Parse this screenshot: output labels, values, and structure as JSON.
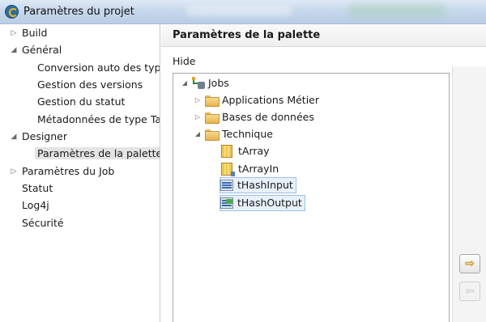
{
  "window": {
    "title": "Paramètres du projet"
  },
  "sidebar": {
    "items": [
      {
        "label": "Build"
      },
      {
        "label": "Général"
      },
      {
        "label": "Conversion auto des type"
      },
      {
        "label": "Gestion des versions"
      },
      {
        "label": "Gestion du statut"
      },
      {
        "label": "Métadonnées de type Tal"
      },
      {
        "label": "Designer"
      },
      {
        "label": "Paramètres de la palette"
      },
      {
        "label": "Paramètres du Job"
      },
      {
        "label": "Statut"
      },
      {
        "label": "Log4j"
      },
      {
        "label": "Sécurité"
      }
    ],
    "twisty": {
      "collapsed": "▷",
      "expanded": "◢"
    }
  },
  "main": {
    "title": "Paramètres de la palette",
    "hide_label": "Hide",
    "tree": [
      {
        "label": "Jobs",
        "icon": "jobs-icon"
      },
      {
        "label": "Applications Métier",
        "icon": "folder-icon"
      },
      {
        "label": "Bases de données",
        "icon": "folder-icon"
      },
      {
        "label": "Technique",
        "icon": "folder-icon"
      },
      {
        "label": "tArray",
        "icon": "component-icon"
      },
      {
        "label": "tArrayIn",
        "icon": "component-icon"
      },
      {
        "label": "tHashInput",
        "icon": "hash-input-icon"
      },
      {
        "label": "tHashOutput",
        "icon": "hash-output-icon"
      }
    ],
    "buttons": {
      "move_right": "⇨",
      "move_left": "⇦"
    }
  },
  "colors": {
    "selection": "#e8f1fb",
    "selection_border": "#9cc0e8",
    "titlebar": "#c7d8ec",
    "arrow_enabled": "#e0a000"
  }
}
